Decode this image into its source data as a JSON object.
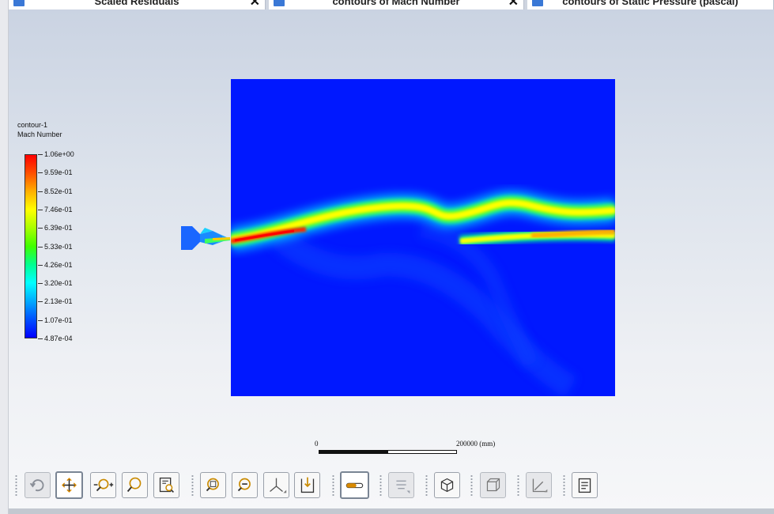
{
  "tabs": [
    {
      "label": "Scaled Residuals",
      "close": "✕"
    },
    {
      "label": "contours of Mach Number",
      "close": "✕"
    },
    {
      "label": "contours of Static Pressure (pascal)",
      "close": ""
    }
  ],
  "legend": {
    "name": "contour-1",
    "variable": "Mach Number",
    "labels": [
      "1.06e+00",
      "9.59e-01",
      "8.52e-01",
      "7.46e-01",
      "6.39e-01",
      "5.33e-01",
      "4.26e-01",
      "3.20e-01",
      "2.13e-01",
      "1.07e-01",
      "4.87e-04"
    ],
    "colors": [
      "#ff0000",
      "#ff5000",
      "#ffb000",
      "#ffff00",
      "#a8ff00",
      "#40ff00",
      "#00ff90",
      "#00ffff",
      "#00aaff",
      "#0050ff",
      "#0000ff"
    ]
  },
  "scale": {
    "zero": "0",
    "max": "200000 (mm)"
  },
  "toolbar": {
    "buttons": [
      "rotate-icon",
      "pan-icon",
      "zoom-in-out-icon",
      "zoom-to-fit-icon",
      "zoom-box-icon",
      "zoom-in-icon",
      "zoom-out-icon",
      "axes-icon",
      "save-view-icon",
      "legend-toggle-icon",
      "lights-icon",
      "isometric-view-icon",
      "view-faces-icon",
      "xy-plot-icon",
      "annotate-icon"
    ]
  },
  "colors": {
    "background_top": "#cad3e2",
    "background_bottom": "#f6f7f9",
    "field_low": "#0018ff",
    "tab_icon": "#3a78d6"
  }
}
